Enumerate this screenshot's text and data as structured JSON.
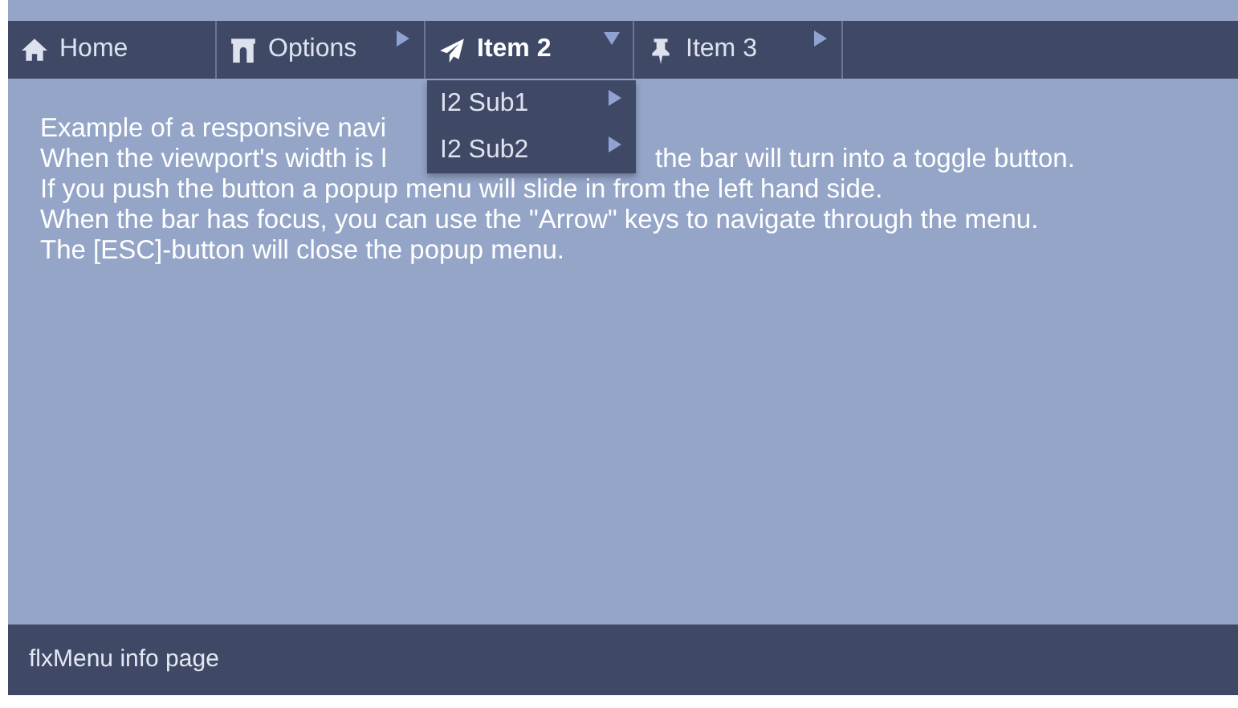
{
  "nav": {
    "items": [
      {
        "label": "Home",
        "kind": "home",
        "has_submenu": false,
        "expanded": false,
        "selected": false
      },
      {
        "label": "Options",
        "kind": "archway",
        "has_submenu": true,
        "expanded": false,
        "selected": false
      },
      {
        "label": "Item 2",
        "kind": "plane",
        "has_submenu": true,
        "expanded": true,
        "selected": true,
        "submenu": [
          {
            "label": "I2 Sub1",
            "has_submenu": true
          },
          {
            "label": "I2 Sub2",
            "has_submenu": true
          }
        ]
      },
      {
        "label": "Item 3",
        "kind": "pin",
        "has_submenu": true,
        "expanded": false,
        "selected": false
      }
    ]
  },
  "content": {
    "lines": [
      {
        "segments": [
          "Example of a responsive navi"
        ]
      },
      {
        "segments": [
          "When the viewport's width is l",
          "the bar will turn into a toggle button."
        ]
      },
      {
        "segments": [
          "If you push the button a popup menu will slide in from the left hand side."
        ]
      },
      {
        "segments": [
          "When the bar has focus, you can use the \"Arrow\" keys to navigate through the menu."
        ]
      },
      {
        "segments": [
          "The [ESC]-button will close the popup menu."
        ]
      }
    ]
  },
  "footer": {
    "text": "flxMenu info page"
  }
}
